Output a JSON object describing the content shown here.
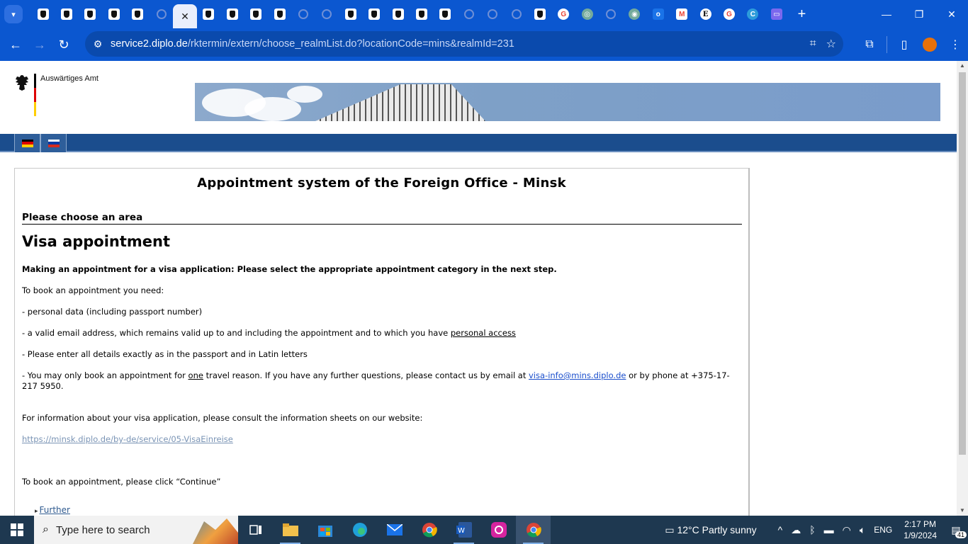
{
  "browser": {
    "url_host": "service2.diplo.de",
    "url_path": "/rktermin/extern/choose_realmList.do?locationCode=mins&realmId=231",
    "tabs": [
      {
        "type": "eagle"
      },
      {
        "type": "eagle"
      },
      {
        "type": "eagle"
      },
      {
        "type": "eagle"
      },
      {
        "type": "eagle"
      },
      {
        "type": "globe"
      },
      {
        "type": "active-close"
      },
      {
        "type": "eagle"
      },
      {
        "type": "eagle"
      },
      {
        "type": "eagle"
      },
      {
        "type": "eagle"
      },
      {
        "type": "globe"
      },
      {
        "type": "globe"
      },
      {
        "type": "eagle"
      },
      {
        "type": "eagle"
      },
      {
        "type": "eagle"
      },
      {
        "type": "eagle"
      },
      {
        "type": "eagle"
      },
      {
        "type": "globe"
      },
      {
        "type": "globe"
      },
      {
        "type": "globe"
      },
      {
        "type": "eagle"
      },
      {
        "type": "g"
      },
      {
        "type": "gpt"
      },
      {
        "type": "globe"
      },
      {
        "type": "g-green"
      },
      {
        "type": "outlook"
      },
      {
        "type": "m"
      },
      {
        "type": "e"
      },
      {
        "type": "g"
      },
      {
        "type": "c"
      },
      {
        "type": "teams"
      }
    ]
  },
  "header": {
    "org_name": "Auswärtiges Amt"
  },
  "page": {
    "title": "Appointment system of the Foreign Office - Minsk",
    "area_heading": "Please choose an area",
    "visa_title": "Visa appointment",
    "intro_bold": "Making an appointment for a visa application: Please select the appropriate appointment category in the next step.",
    "need_label": "To book an appointment you need:",
    "item1": "- personal data (including passport number)",
    "item2_pre": "- a valid email address, which remains valid up to and including the appointment and to which you have ",
    "item2_link": "personal access",
    "item3": "- Please enter all details exactly as in the passport and in Latin letters",
    "item4_pre": "- You may only book an appointment for ",
    "item4_one": "one",
    "item4_mid": " travel reason. If you have any further questions, please contact us by email at ",
    "item4_email": "visa-info@mins.diplo.de",
    "item4_post": " or by phone at +375-17-217 5950.",
    "info_text": "For information about your visa application, please consult the information sheets on our website:",
    "info_link": "https://minsk.diplo.de/by-de/service/05-VisaEinreise",
    "continue_text": "To book an appointment, please click “Continue”",
    "further_link": "Further"
  },
  "taskbar": {
    "search_placeholder": "Type here to search",
    "weather": "12°C  Partly sunny",
    "lang": "ENG",
    "time": "2:17 PM",
    "date": "1/9/2024",
    "notifications": "41"
  },
  "colors": {
    "chrome_blue": "#0b57d0",
    "lang_bar": "#1b4d8d",
    "taskbar": "#1e3850"
  }
}
